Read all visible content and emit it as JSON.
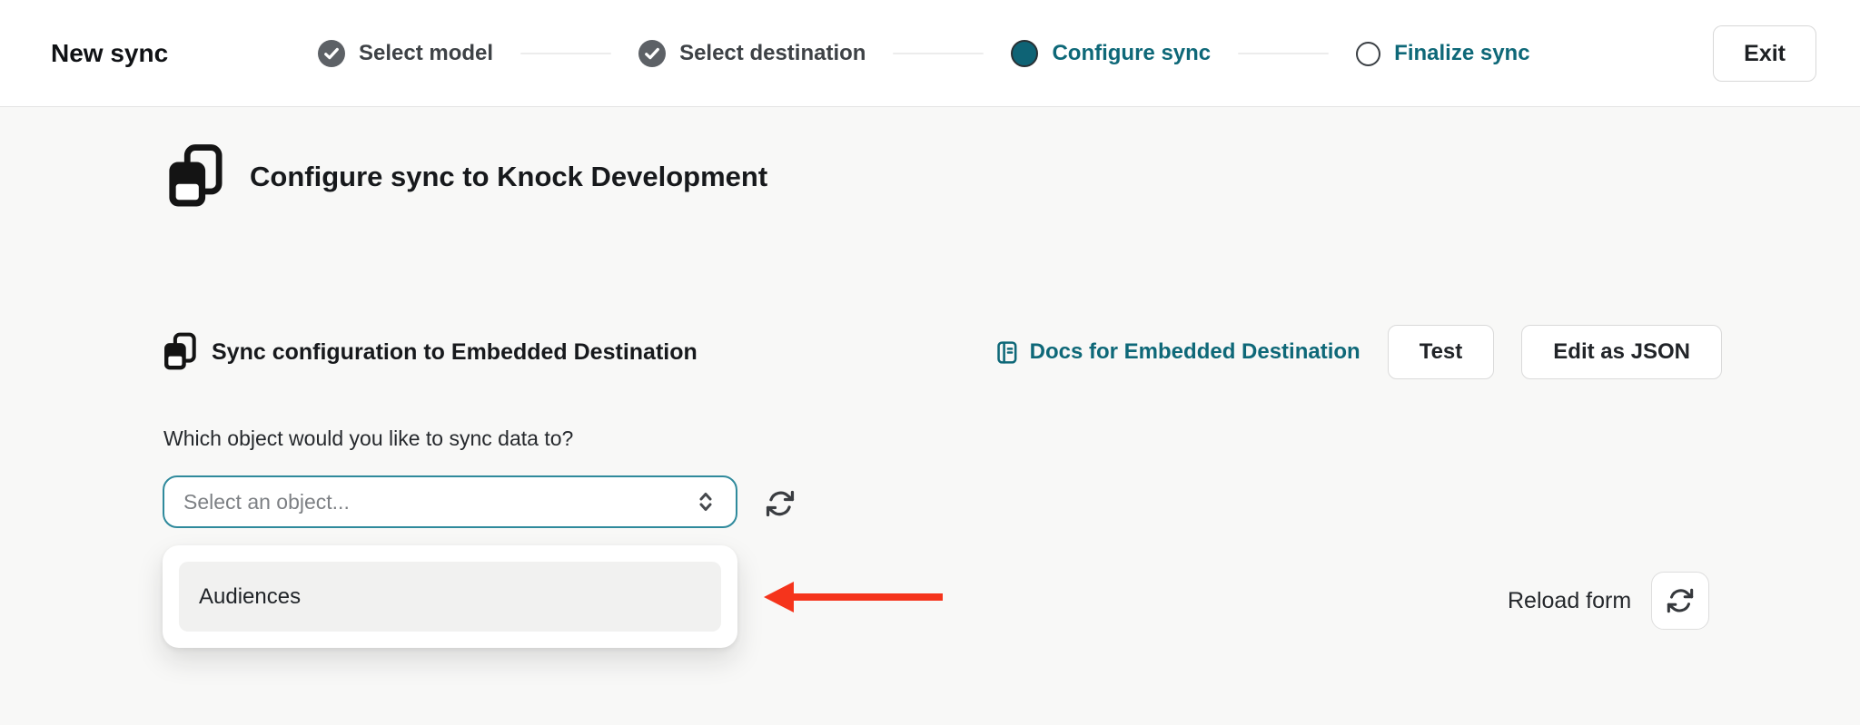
{
  "colors": {
    "teal": "#0e6878",
    "teal_fill": "#0e6375",
    "arrow_red": "#f5341c",
    "step_gray": "#5d6166"
  },
  "header": {
    "title": "New sync",
    "steps": [
      {
        "label": "Select model",
        "state": "complete"
      },
      {
        "label": "Select destination",
        "state": "complete"
      },
      {
        "label": "Configure sync",
        "state": "active"
      },
      {
        "label": "Finalize sync",
        "state": "upcoming"
      }
    ],
    "exit_label": "Exit"
  },
  "main": {
    "hero_title": "Configure sync to Knock Development",
    "section": {
      "title": "Sync configuration to Embedded Destination",
      "docs_link_label": "Docs for Embedded Destination",
      "test_label": "Test",
      "edit_json_label": "Edit as JSON"
    },
    "form": {
      "question": "Which object would you like to sync data to?",
      "select_placeholder": "Select an object...",
      "dropdown_options": [
        "Audiences"
      ],
      "reload_label": "Reload form"
    }
  },
  "icons": {
    "check_icon": "checkmark in filled circle",
    "destination_icon": "stacked browser windows",
    "book_icon": "docs book",
    "chevron_up_down_icon": "select chevrons",
    "refresh_icon": "circular sync arrows",
    "annotation_arrow": "red arrow pointing left"
  }
}
